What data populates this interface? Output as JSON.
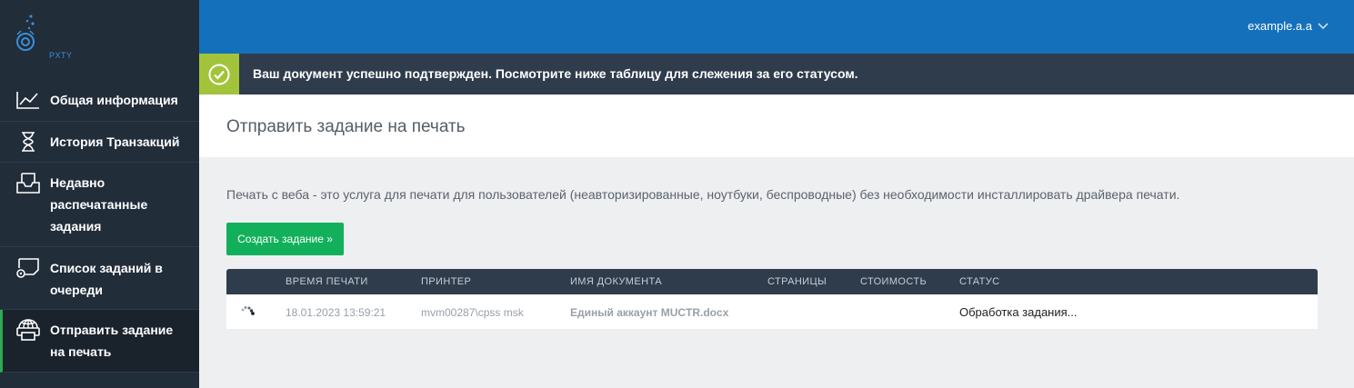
{
  "app": {
    "logo_text": "PXTY",
    "logo_sub": "· · · · · ·"
  },
  "header": {
    "user_name": "example.a.a"
  },
  "sidebar": {
    "items": [
      {
        "label": "Общая информация",
        "icon": "chart-line-icon"
      },
      {
        "label": "История Транзакций",
        "icon": "hourglass-icon"
      },
      {
        "label": "Недавно распечатанные задания",
        "icon": "inbox-tray-icon"
      },
      {
        "label": "Список заданий в очереди",
        "icon": "print-queue-icon"
      },
      {
        "label": "Отправить задание на печать",
        "icon": "web-print-icon",
        "active": true
      }
    ]
  },
  "alert": {
    "text": "Ваш документ успешно подтвержден. Посмотрите ниже таблицу для слежения за его статусом."
  },
  "page": {
    "title": "Отправить задание на печать",
    "description": "Печать с веба - это услуга для печати для пользователей (неавторизированные, ноутбуки, беспроводные) без необходимости инсталлировать драйвера печати.",
    "create_button": "Создать задание »"
  },
  "table": {
    "columns": [
      "ВРЕМЯ ПЕЧАТИ",
      "ПРИНТЕР",
      "ИМЯ ДОКУМЕНТА",
      "СТРАНИЦЫ",
      "СТОИМОСТЬ",
      "СТАТУС"
    ],
    "rows": [
      {
        "time": "18.01.2023 13:59:21",
        "printer": "mvm00287\\cpss msk",
        "document": "Единый аккаунт MUCTR.docx",
        "pages": "",
        "cost": "",
        "status": "Обработка задания..."
      }
    ]
  },
  "colors": {
    "sidebar_bg": "#222d3a",
    "header_bg": "#1470bb",
    "alert_bg": "#2f3c4c",
    "success": "#a3c43a",
    "button": "#12b05a",
    "active_marker": "#2dab53"
  }
}
